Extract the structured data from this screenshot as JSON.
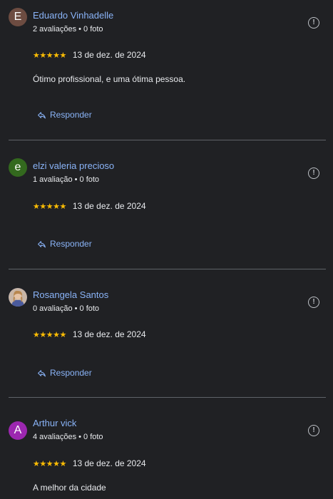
{
  "reviews": [
    {
      "initial": "E",
      "avatar_color": "#6d4c41",
      "name": "Eduardo Vinhadelle",
      "review_count": "2 avaliações",
      "photo_count": "0 foto",
      "rating": 5,
      "stars": "★★★★★",
      "date": "13 de dez. de 2024",
      "text": "Ótimo profissional, e uma ótima pessoa.",
      "reply_label": "Responder"
    },
    {
      "initial": "e",
      "avatar_color": "#33691e",
      "name": "elzi valeria precioso",
      "review_count": "1 avaliação",
      "photo_count": "0 foto",
      "rating": 5,
      "stars": "★★★★★",
      "date": "13 de dez. de 2024",
      "text": "",
      "reply_label": "Responder"
    },
    {
      "initial": "",
      "avatar_color": "",
      "name": "Rosangela Santos",
      "review_count": "0 avaliação",
      "photo_count": "0 foto",
      "rating": 5,
      "stars": "★★★★★",
      "date": "13 de dez. de 2024",
      "text": "",
      "reply_label": "Responder"
    },
    {
      "initial": "A",
      "avatar_color": "#9c27b0",
      "name": "Arthur vick",
      "review_count": "4 avaliações",
      "photo_count": "0 foto",
      "rating": 5,
      "stars": "★★★★★",
      "date": "13 de dez. de 2024",
      "text": "A melhor da cidade",
      "reply_label": ""
    }
  ],
  "icons": {
    "more": "alert-circle-icon",
    "reply": "reply-arrow-icon",
    "star": "star-icon"
  },
  "colors": {
    "background": "#202124",
    "link": "#8ab4f8",
    "star": "#fbbc04",
    "divider": "#5f6368"
  }
}
